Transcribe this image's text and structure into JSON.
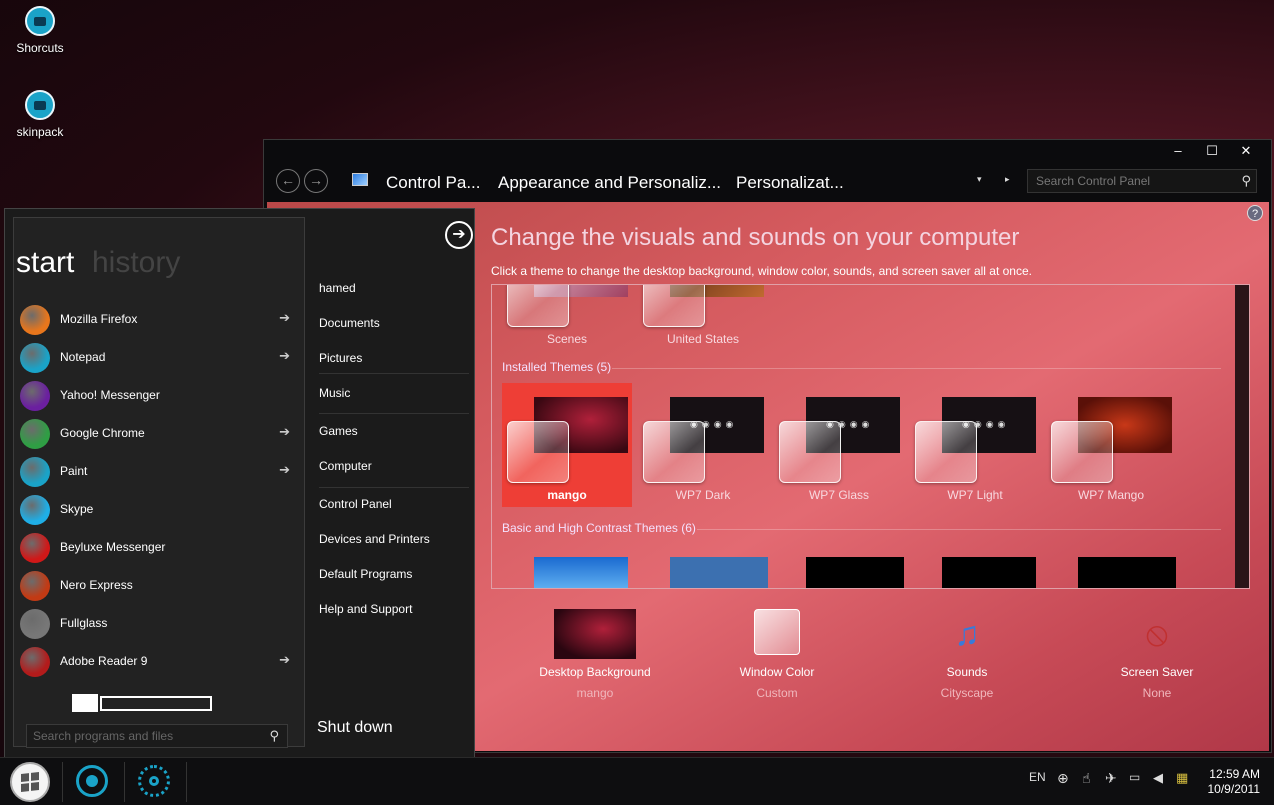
{
  "desktop": {
    "icons": [
      {
        "label": "Shorcuts",
        "icon": "folder-icon"
      },
      {
        "label": "skinpack",
        "icon": "folder-icon"
      }
    ]
  },
  "control_panel": {
    "caption": {
      "minimize": "‒",
      "maximize": "☐",
      "close": "✕"
    },
    "nav": {
      "back": "←",
      "forward": "→"
    },
    "breadcrumbs": [
      "Control Pa...",
      "Appearance and Personaliz...",
      "Personalizat..."
    ],
    "breadcrumb_dropdown": "▾",
    "breadcrumb_arrow": "▸",
    "search_placeholder": "Search Control Panel",
    "help": "?",
    "heading": "Change the visuals and sounds on your computer",
    "subheading": "Click a theme to change the desktop background, window color, sounds, and screen saver all at once.",
    "my_themes_partial": [
      "Scenes",
      "United States"
    ],
    "installed_section": "Installed Themes (5)",
    "installed_themes": [
      {
        "name": "mango",
        "selected": true
      },
      {
        "name": "WP7 Dark",
        "selected": false
      },
      {
        "name": "WP7 Glass",
        "selected": false
      },
      {
        "name": "WP7 Light",
        "selected": false
      },
      {
        "name": "WP7 Mango",
        "selected": false
      }
    ],
    "basic_section": "Basic and High Contrast Themes (6)",
    "bottom": [
      {
        "title": "Desktop Background",
        "value": "mango",
        "icon": "desktop-background-icon"
      },
      {
        "title": "Window Color",
        "value": "Custom",
        "icon": "window-color-icon"
      },
      {
        "title": "Sounds",
        "value": "Cityscape",
        "icon": "sounds-icon"
      },
      {
        "title": "Screen Saver",
        "value": "None",
        "icon": "screen-saver-icon"
      }
    ]
  },
  "start_menu": {
    "title": "start",
    "history_title": "history",
    "programs": [
      {
        "label": "Mozilla Firefox",
        "arrow": true,
        "color": "#e8761c"
      },
      {
        "label": "Notepad",
        "arrow": true,
        "color": "#1aa3c8"
      },
      {
        "label": "Yahoo! Messenger",
        "arrow": false,
        "color": "#6b1fa0"
      },
      {
        "label": "Google Chrome",
        "arrow": true,
        "color": "#2f9e44"
      },
      {
        "label": "Paint",
        "arrow": true,
        "color": "#1aa3c8"
      },
      {
        "label": "Skype",
        "arrow": false,
        "color": "#1faee6"
      },
      {
        "label": "Beyluxe Messenger",
        "arrow": false,
        "color": "#d01818"
      },
      {
        "label": "Nero Express",
        "arrow": false,
        "color": "#c23a14"
      },
      {
        "label": "Fullglass",
        "arrow": false,
        "color": "#777777"
      },
      {
        "label": "Adobe Reader 9",
        "arrow": true,
        "color": "#b31b1b"
      }
    ],
    "arrow_glyph": "➔",
    "search_placeholder": "Search programs and files",
    "places": [
      "hamed",
      "Documents",
      "Pictures",
      "Music",
      "Games",
      "Computer",
      "Control Panel",
      "Devices and Printers",
      "Default Programs",
      "Help and Support"
    ],
    "shutdown": "Shut down",
    "goto": "➔"
  },
  "taskbar": {
    "language": "EN",
    "time": "12:59 AM",
    "date": "10/9/2011"
  },
  "colors": {
    "accent": "#1aa3c8",
    "selected_theme": "#ee3e36"
  }
}
